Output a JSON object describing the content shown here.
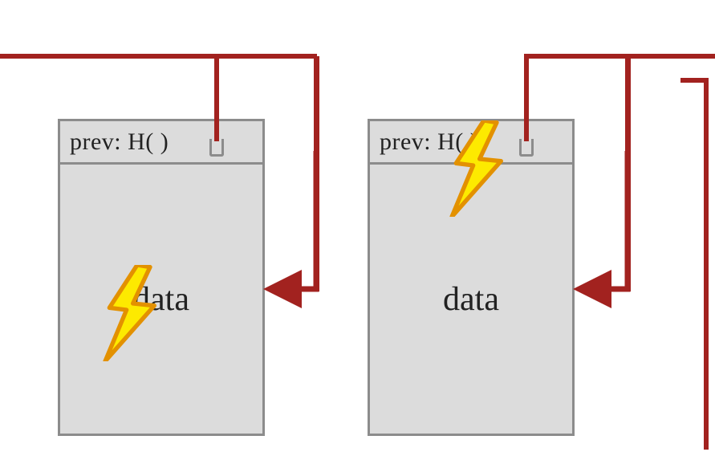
{
  "diagram": {
    "blocks": [
      {
        "header": "prev: H(   )",
        "body": "data"
      },
      {
        "header": "prev: H(   )",
        "body": "data"
      }
    ],
    "connector_color": "#a2221f",
    "bolt_fill": "#fdea00",
    "bolt_stroke": "#e39100"
  }
}
